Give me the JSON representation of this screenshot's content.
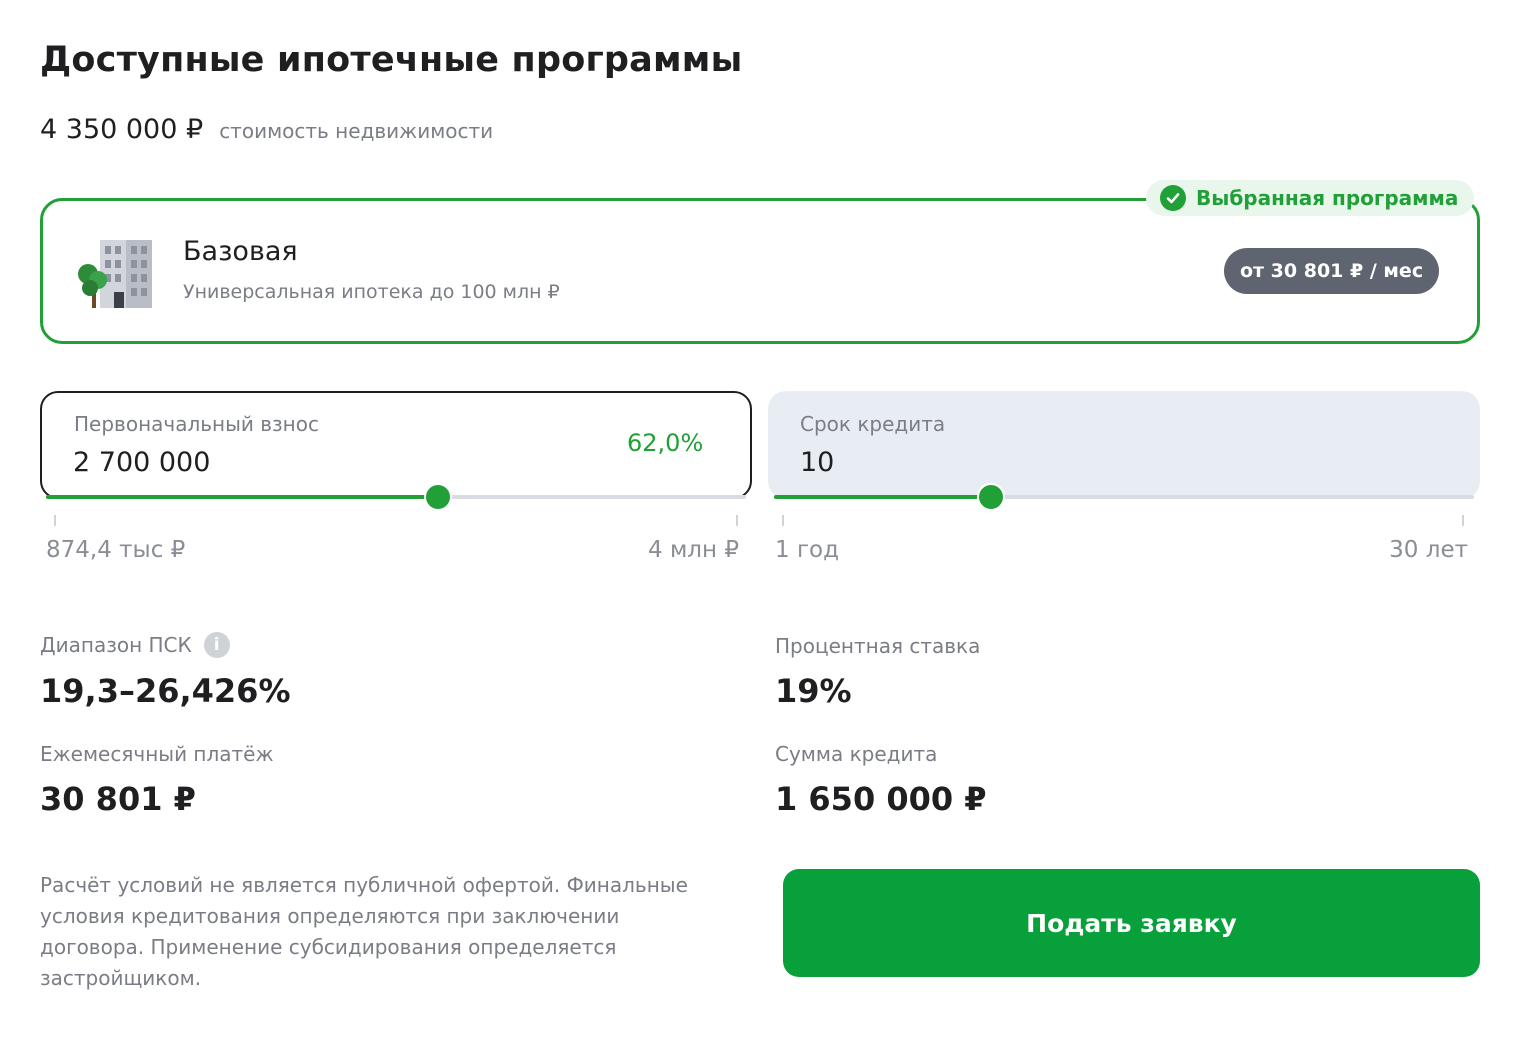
{
  "header": {
    "title": "Доступные ипотечные программы",
    "property_price": "4 350 000 ₽",
    "property_price_label": "стоимость недвижимости"
  },
  "program": {
    "selected_badge": "Выбранная программа",
    "name": "Базовая",
    "description": "Универсальная ипотека до 100 млн ₽",
    "monthly_from": "от 30 801 ₽ / мес",
    "icon": "building-icon"
  },
  "down_payment": {
    "label": "Первоначальный взнос",
    "value": "2 700 000",
    "percent": "62,0%",
    "min_label": "874,4 тыс ₽",
    "max_label": "4 млн ₽",
    "slider_position": 0.56
  },
  "term": {
    "label": "Срок кредита",
    "value": "10",
    "min_label": "1 год",
    "max_label": "30 лет",
    "slider_position": 0.31
  },
  "stats": {
    "psk_label": "Диапазон ПСК",
    "psk_value": "19,3–26,426%",
    "rate_label": "Процентная ставка",
    "rate_value": "19%",
    "monthly_label": "Ежемесячный платёж",
    "monthly_value": "30 801 ₽",
    "loan_label": "Сумма кредита",
    "loan_value": "1 650 000 ₽"
  },
  "disclaimer": "Расчёт условий не является публичной офертой. Финальные условия кредитования определяются при заключении договора. Применение субсидирования определяется застройщиком.",
  "submit_label": "Подать заявку",
  "colors": {
    "accent": "#21a038",
    "button": "#07a03a",
    "badge_dark": "#5e6571",
    "field_bg": "#e8edf3"
  }
}
